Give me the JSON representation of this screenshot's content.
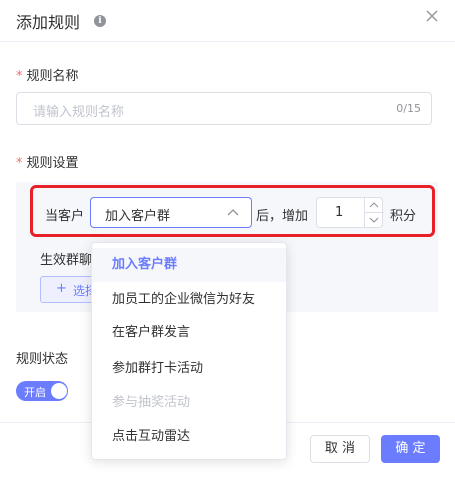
{
  "dialog": {
    "title": "添加规则",
    "info_icon": "i"
  },
  "rule_name": {
    "label": "规则名称",
    "required_mark": "*",
    "placeholder": "请输入规则名称",
    "counter": "0/15"
  },
  "rule_settings": {
    "label": "规则设置",
    "required_mark": "*",
    "prefix": "当客户",
    "selected_action": "加入客户群",
    "middle_text": "后，增加",
    "points_value": "1",
    "suffix": "积分",
    "effective_group_label": "生效群聊",
    "pick_button_plus": "+",
    "pick_button_label": "选择"
  },
  "rule_status": {
    "label": "规则状态",
    "toggle_label": "开启"
  },
  "footer": {
    "cancel_label": "取 消",
    "confirm_label": "确 定"
  },
  "dropdown": {
    "items": [
      {
        "label": "加入客户群",
        "selected": true,
        "disabled": false
      },
      {
        "label": "加员工的企业微信为好友",
        "selected": false,
        "disabled": false
      },
      {
        "label": "在客户群发言",
        "selected": false,
        "disabled": false
      },
      {
        "label": "参加群打卡活动",
        "selected": false,
        "disabled": false
      },
      {
        "label": "参与抽奖活动",
        "selected": false,
        "disabled": true
      },
      {
        "label": "点击互动雷达",
        "selected": false,
        "disabled": false
      }
    ]
  },
  "colors": {
    "accent": "#6b7cff",
    "highlight_frame": "#e8202a",
    "required": "#f56c6c"
  }
}
